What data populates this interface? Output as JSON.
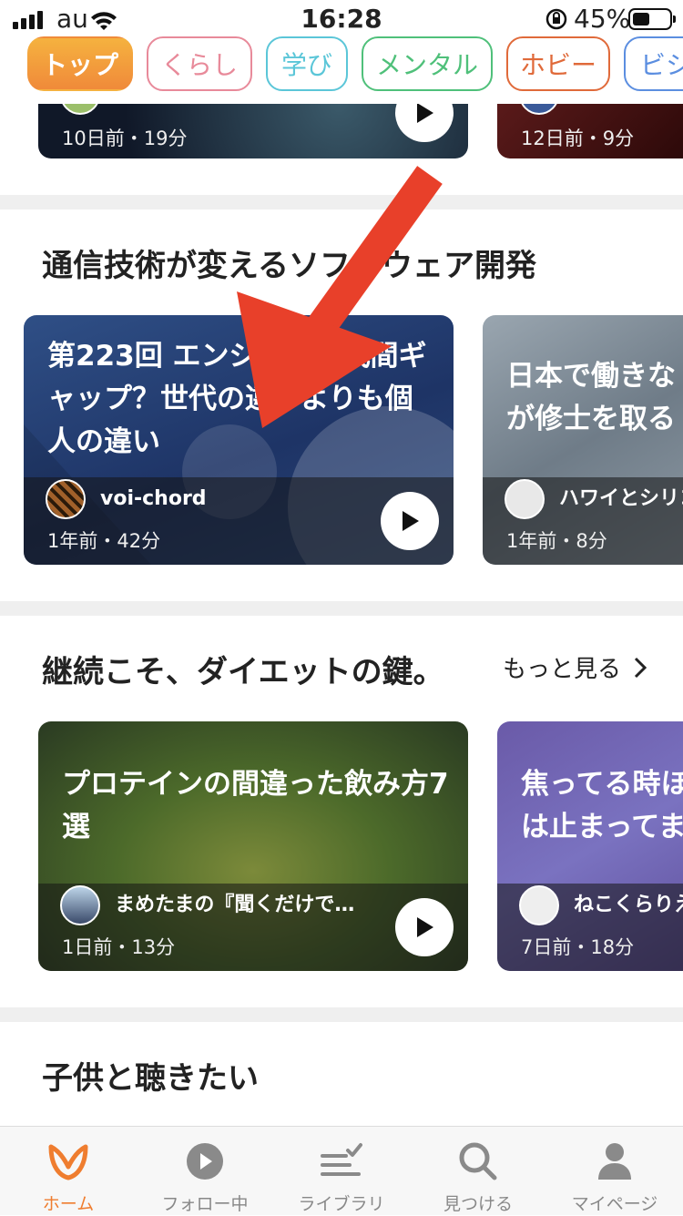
{
  "status": {
    "carrier": "au",
    "time": "16:28",
    "battery": "45%"
  },
  "tabs": [
    {
      "label": "トップ",
      "color": "#f08a3a",
      "active": true
    },
    {
      "label": "くらし",
      "color": "#e88a9a"
    },
    {
      "label": "学び",
      "color": "#5bc6d8"
    },
    {
      "label": "メンタル",
      "color": "#4fc07a"
    },
    {
      "label": "ホビー",
      "color": "#e06a3a"
    },
    {
      "label": "ビシ",
      "color": "#5b8ee0"
    }
  ],
  "top_row": [
    {
      "meta": "10日前・19分"
    },
    {
      "meta": "12日前・9分"
    }
  ],
  "section1": {
    "title": "通信技術が変えるソフトウェア開発",
    "cards": [
      {
        "title": "第223回 エンジニア世代間ギャップ？世代の違いよりも個人の違い",
        "author": "voi-chord",
        "meta": "1年前・42分"
      },
      {
        "title": "日本で働きなが修士を取る",
        "author": "ハワイとシリコ",
        "meta": "1年前・8分"
      }
    ]
  },
  "section2": {
    "title": "継続こそ、ダイエットの鍵。",
    "more": "もっと見る",
    "cards": [
      {
        "title": "プロテインの間違った飲み方7選",
        "author": "まめたまの『聞くだけで…",
        "meta": "1日前・13分"
      },
      {
        "title": "焦ってる時ほは止まってま",
        "author": "ねこくらりえ",
        "meta": "7日前・18分"
      }
    ]
  },
  "section3": {
    "title": "子供と聴きたい"
  },
  "nav": [
    {
      "label": "ホーム",
      "icon": "home-icon",
      "active": true
    },
    {
      "label": "フォロー中",
      "icon": "play-circle-icon"
    },
    {
      "label": "ライブラリ",
      "icon": "library-icon"
    },
    {
      "label": "見つける",
      "icon": "search-icon"
    },
    {
      "label": "マイページ",
      "icon": "person-icon"
    }
  ],
  "accent_color": "#ef7d2f"
}
